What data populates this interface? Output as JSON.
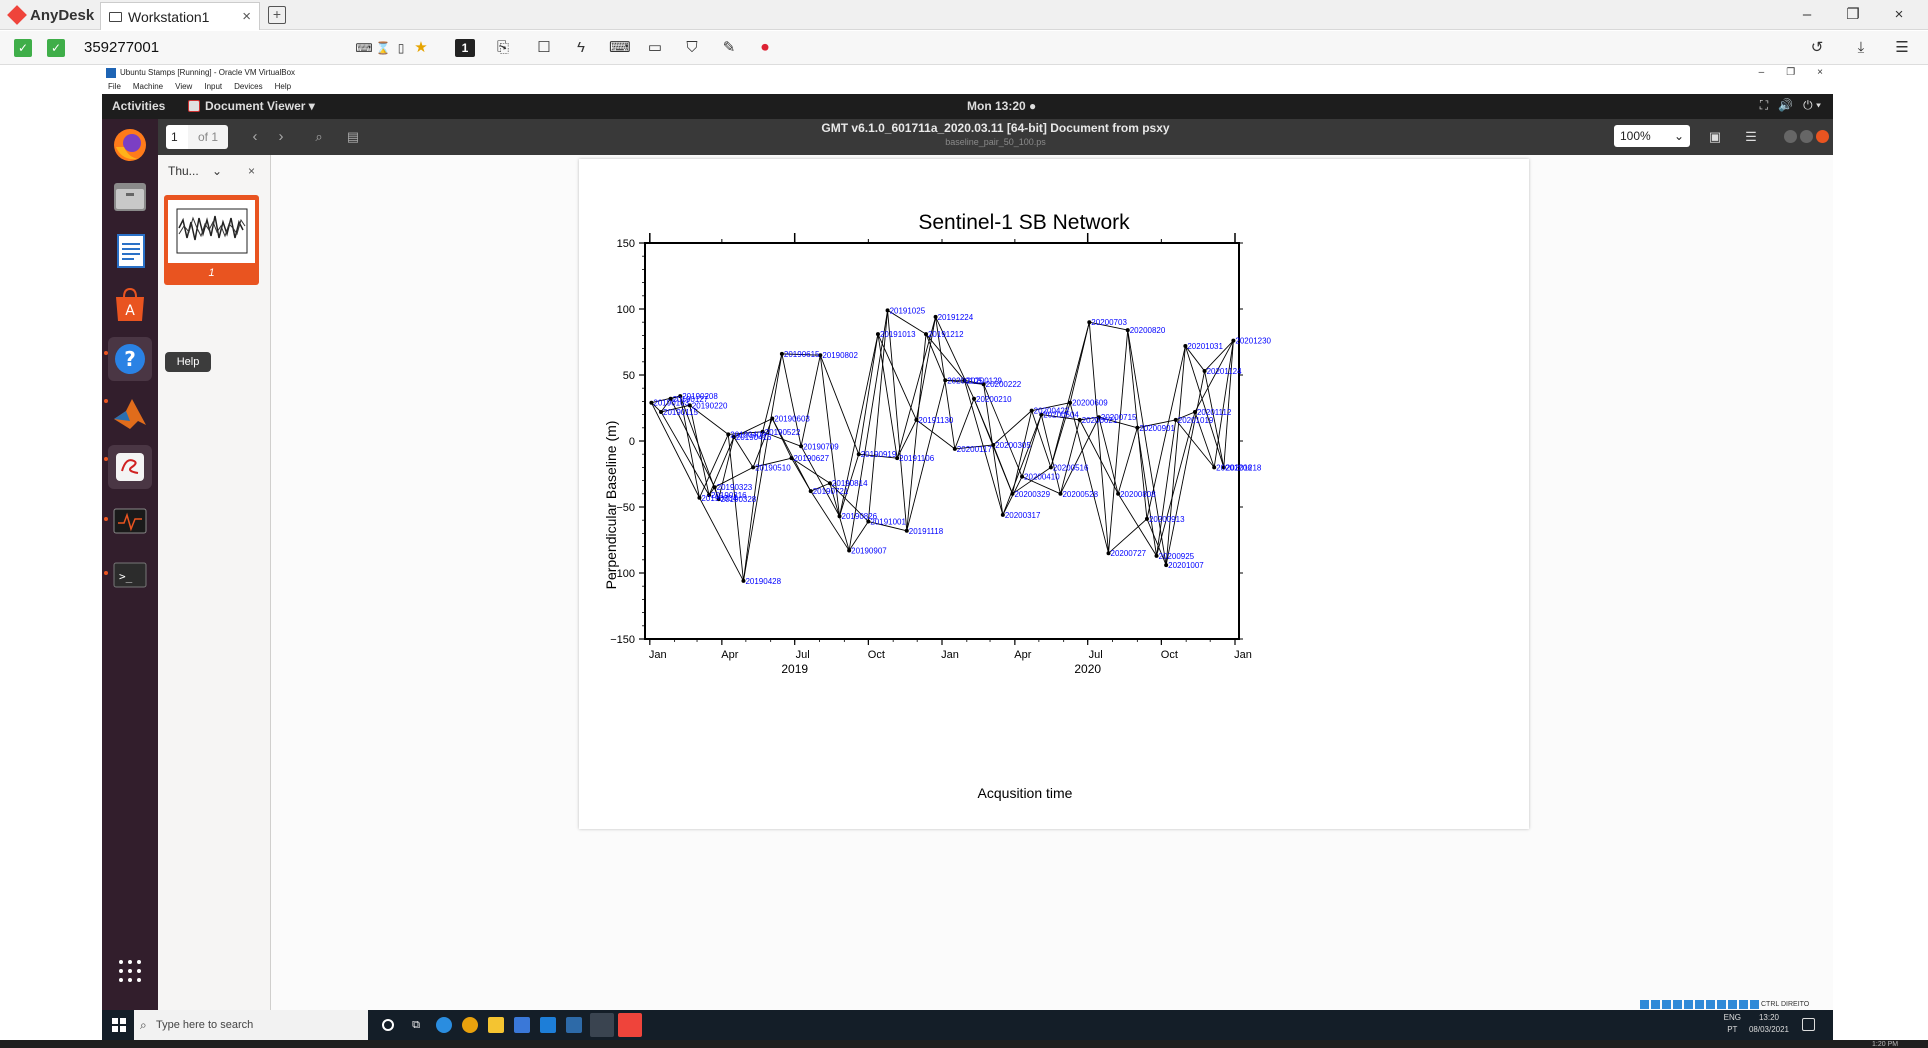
{
  "anydesk": {
    "brand": "AnyDesk",
    "tab_label": "Workstation1",
    "tab_close": "×",
    "new_tab": "+",
    "address": "359277001",
    "display_number": "1",
    "window_controls": [
      "–",
      "❐",
      "×"
    ]
  },
  "vbox": {
    "title": "Ubuntu Stamps [Running] - Oracle VM VirtualBox",
    "menu": [
      "File",
      "Machine",
      "View",
      "Input",
      "Devices",
      "Help"
    ],
    "window_controls": [
      "–",
      "❐",
      "×"
    ],
    "status_host_key": "CTRL DIREITO"
  },
  "ubuntu": {
    "activities": "Activities",
    "app_name": "Document Viewer ▾",
    "clock": "Mon 13:20 ●",
    "status_icons": [
      "⛶",
      "🔊",
      "⏻ ▾"
    ],
    "help_tooltip": "Help",
    "dock_items": [
      "firefox-icon",
      "files-icon",
      "writer-icon",
      "software-icon",
      "help-icon",
      "matlab-icon",
      "document-viewer-icon",
      "system-monitor-icon",
      "terminal-icon",
      "show-apps-icon"
    ]
  },
  "evince": {
    "page_number": "1",
    "page_of": "of 1",
    "title": "GMT v6.1.0_601711a_2020.03.11 [64-bit] Document from psxy",
    "subtitle": "baseline_pair_50_100.ps",
    "zoom": "100%",
    "sidebar_mode": "Thu...",
    "sidebar_mode_chevron": "⌄",
    "sidebar_close": "×",
    "thumbnail_page": "1"
  },
  "chart_data": {
    "type": "scatter",
    "title": "Sentinel-1 SB Network",
    "xlabel": "Acqusition time",
    "ylabel": "Perpendicular Baseline (m)",
    "ylim": [
      -150,
      150
    ],
    "yticks": [
      -150,
      -100,
      -50,
      0,
      50,
      100,
      150
    ],
    "ytick_labels": [
      "−150",
      "−100",
      "−50",
      "0",
      "50",
      "100",
      "150"
    ],
    "xlim": [
      "2018-12-26",
      "2021-01-06"
    ],
    "xtick_dates": [
      "2019-01-01",
      "2019-04-01",
      "2019-07-01",
      "2019-10-01",
      "2020-01-01",
      "2020-04-01",
      "2020-07-01",
      "2020-10-01",
      "2021-01-01"
    ],
    "xtick_labels": [
      "Jan",
      "Apr",
      "Jul",
      "Oct",
      "Jan",
      "Apr",
      "Jul",
      "Oct",
      "Jan"
    ],
    "year_ticks": [
      "2019-07-01",
      "2020-07-01"
    ],
    "year_labels": [
      "2019",
      "2020"
    ],
    "point_color": "#0000ff",
    "line_color": "#000000",
    "points": [
      {
        "date": "2019-01-03",
        "y": 29,
        "label": "20190103"
      },
      {
        "date": "2019-01-15",
        "y": 22,
        "label": "20190115"
      },
      {
        "date": "2019-01-27",
        "y": 32,
        "label": "20190127"
      },
      {
        "date": "2019-02-08",
        "y": 34,
        "label": "20190208"
      },
      {
        "date": "2019-02-20",
        "y": 27,
        "label": "20190220"
      },
      {
        "date": "2019-03-04",
        "y": -43,
        "label": "20190304"
      },
      {
        "date": "2019-03-16",
        "y": -41,
        "label": "20190316"
      },
      {
        "date": "2019-03-23",
        "y": -35,
        "label": "20190323"
      },
      {
        "date": "2019-03-28",
        "y": -44,
        "label": "20190328"
      },
      {
        "date": "2019-04-09",
        "y": 5,
        "label": "20190409"
      },
      {
        "date": "2019-04-16",
        "y": 3,
        "label": "20190416"
      },
      {
        "date": "2019-04-28",
        "y": -106,
        "label": "20190428"
      },
      {
        "date": "2019-05-10",
        "y": -20,
        "label": "20190510"
      },
      {
        "date": "2019-05-22",
        "y": 7,
        "label": "20190522"
      },
      {
        "date": "2019-06-03",
        "y": 17,
        "label": "20190603"
      },
      {
        "date": "2019-06-15",
        "y": 66,
        "label": "20190615"
      },
      {
        "date": "2019-06-27",
        "y": -13,
        "label": "20190627"
      },
      {
        "date": "2019-07-09",
        "y": -4,
        "label": "20190709"
      },
      {
        "date": "2019-07-21",
        "y": -38,
        "label": "20190721"
      },
      {
        "date": "2019-08-02",
        "y": 65,
        "label": "20190802"
      },
      {
        "date": "2019-08-14",
        "y": -32,
        "label": "20190814"
      },
      {
        "date": "2019-08-26",
        "y": -57,
        "label": "20190826"
      },
      {
        "date": "2019-09-07",
        "y": -83,
        "label": "20190907"
      },
      {
        "date": "2019-09-19",
        "y": -10,
        "label": "20190919"
      },
      {
        "date": "2019-10-01",
        "y": -61,
        "label": "20191001"
      },
      {
        "date": "2019-10-13",
        "y": 81,
        "label": "20191013"
      },
      {
        "date": "2019-10-25",
        "y": 99,
        "label": "20191025"
      },
      {
        "date": "2019-11-06",
        "y": -13,
        "label": "20191106"
      },
      {
        "date": "2019-11-18",
        "y": -68,
        "label": "20191118"
      },
      {
        "date": "2019-11-30",
        "y": 16,
        "label": "20191130"
      },
      {
        "date": "2019-12-12",
        "y": 81,
        "label": "20191212"
      },
      {
        "date": "2019-12-24",
        "y": 94,
        "label": "20191224"
      },
      {
        "date": "2020-01-05",
        "y": 46,
        "label": "20200105"
      },
      {
        "date": "2020-01-17",
        "y": -6,
        "label": "20200117"
      },
      {
        "date": "2020-01-29",
        "y": 46,
        "label": "20200129"
      },
      {
        "date": "2020-02-10",
        "y": 32,
        "label": "20200210"
      },
      {
        "date": "2020-02-22",
        "y": 43,
        "label": "20200222"
      },
      {
        "date": "2020-03-05",
        "y": -3,
        "label": "20200305"
      },
      {
        "date": "2020-03-17",
        "y": -56,
        "label": "20200317"
      },
      {
        "date": "2020-03-29",
        "y": -40,
        "label": "20200329"
      },
      {
        "date": "2020-04-10",
        "y": -27,
        "label": "20200410"
      },
      {
        "date": "2020-04-22",
        "y": 23,
        "label": "20200422"
      },
      {
        "date": "2020-05-04",
        "y": 20,
        "label": "20200504"
      },
      {
        "date": "2020-05-16",
        "y": -20,
        "label": "20200516"
      },
      {
        "date": "2020-05-28",
        "y": -40,
        "label": "20200528"
      },
      {
        "date": "2020-06-09",
        "y": 29,
        "label": "20200609"
      },
      {
        "date": "2020-06-21",
        "y": 16,
        "label": "20200621"
      },
      {
        "date": "2020-07-03",
        "y": 90,
        "label": "20200703"
      },
      {
        "date": "2020-07-15",
        "y": 18,
        "label": "20200715"
      },
      {
        "date": "2020-07-27",
        "y": -85,
        "label": "20200727"
      },
      {
        "date": "2020-08-08",
        "y": -40,
        "label": "20200808"
      },
      {
        "date": "2020-08-20",
        "y": 84,
        "label": "20200820"
      },
      {
        "date": "2020-09-01",
        "y": 10,
        "label": "20200901"
      },
      {
        "date": "2020-09-13",
        "y": -59,
        "label": "20200913"
      },
      {
        "date": "2020-09-25",
        "y": -87,
        "label": "20200925"
      },
      {
        "date": "2020-10-07",
        "y": -94,
        "label": "20201007"
      },
      {
        "date": "2020-10-19",
        "y": 16,
        "label": "20201019"
      },
      {
        "date": "2020-10-31",
        "y": 72,
        "label": "20201031"
      },
      {
        "date": "2020-11-12",
        "y": 22,
        "label": "20201112"
      },
      {
        "date": "2020-11-24",
        "y": 53,
        "label": "20201124"
      },
      {
        "date": "2020-12-06",
        "y": -20,
        "label": "20201206"
      },
      {
        "date": "2020-12-18",
        "y": -20,
        "label": "20201218"
      },
      {
        "date": "2020-12-30",
        "y": 76,
        "label": "20201230"
      }
    ],
    "pairs": [
      [
        0,
        1
      ],
      [
        0,
        3
      ],
      [
        0,
        5
      ],
      [
        1,
        2
      ],
      [
        1,
        4
      ],
      [
        1,
        6
      ],
      [
        2,
        3
      ],
      [
        2,
        7
      ],
      [
        3,
        5
      ],
      [
        3,
        8
      ],
      [
        4,
        6
      ],
      [
        4,
        9
      ],
      [
        5,
        9
      ],
      [
        5,
        11
      ],
      [
        6,
        10
      ],
      [
        6,
        7
      ],
      [
        7,
        8
      ],
      [
        7,
        12
      ],
      [
        8,
        10
      ],
      [
        9,
        11
      ],
      [
        9,
        13
      ],
      [
        10,
        12
      ],
      [
        10,
        14
      ],
      [
        11,
        13
      ],
      [
        11,
        15
      ],
      [
        12,
        14
      ],
      [
        12,
        16
      ],
      [
        13,
        15
      ],
      [
        13,
        17
      ],
      [
        14,
        16
      ],
      [
        14,
        18
      ],
      [
        15,
        17
      ],
      [
        15,
        19
      ],
      [
        16,
        18
      ],
      [
        16,
        20
      ],
      [
        17,
        19
      ],
      [
        17,
        21
      ],
      [
        18,
        20
      ],
      [
        18,
        22
      ],
      [
        19,
        21
      ],
      [
        19,
        23
      ],
      [
        20,
        22
      ],
      [
        20,
        24
      ],
      [
        21,
        23
      ],
      [
        21,
        25
      ],
      [
        22,
        24
      ],
      [
        22,
        26
      ],
      [
        23,
        25
      ],
      [
        23,
        27
      ],
      [
        24,
        26
      ],
      [
        24,
        28
      ],
      [
        25,
        27
      ],
      [
        25,
        29
      ],
      [
        26,
        28
      ],
      [
        26,
        30
      ],
      [
        27,
        29
      ],
      [
        27,
        31
      ],
      [
        28,
        30
      ],
      [
        28,
        32
      ],
      [
        29,
        31
      ],
      [
        29,
        33
      ],
      [
        30,
        32
      ],
      [
        30,
        34
      ],
      [
        31,
        33
      ],
      [
        31,
        35
      ],
      [
        32,
        34
      ],
      [
        32,
        36
      ],
      [
        33,
        35
      ],
      [
        33,
        37
      ],
      [
        34,
        36
      ],
      [
        34,
        38
      ],
      [
        35,
        37
      ],
      [
        35,
        39
      ],
      [
        36,
        38
      ],
      [
        36,
        40
      ],
      [
        37,
        39
      ],
      [
        37,
        41
      ],
      [
        38,
        40
      ],
      [
        38,
        42
      ],
      [
        39,
        41
      ],
      [
        39,
        43
      ],
      [
        40,
        42
      ],
      [
        40,
        44
      ],
      [
        41,
        43
      ],
      [
        41,
        45
      ],
      [
        42,
        44
      ],
      [
        42,
        46
      ],
      [
        43,
        45
      ],
      [
        43,
        47
      ],
      [
        44,
        46
      ],
      [
        44,
        48
      ],
      [
        45,
        47
      ],
      [
        45,
        49
      ],
      [
        46,
        48
      ],
      [
        46,
        50
      ],
      [
        47,
        49
      ],
      [
        47,
        51
      ],
      [
        48,
        50
      ],
      [
        48,
        52
      ],
      [
        49,
        51
      ],
      [
        49,
        53
      ],
      [
        50,
        52
      ],
      [
        50,
        54
      ],
      [
        51,
        53
      ],
      [
        51,
        55
      ],
      [
        52,
        54
      ],
      [
        52,
        56
      ],
      [
        53,
        55
      ],
      [
        53,
        57
      ],
      [
        54,
        56
      ],
      [
        54,
        58
      ],
      [
        55,
        57
      ],
      [
        55,
        59
      ],
      [
        56,
        58
      ],
      [
        56,
        60
      ],
      [
        57,
        59
      ],
      [
        57,
        61
      ],
      [
        58,
        60
      ],
      [
        58,
        62
      ],
      [
        59,
        61
      ],
      [
        59,
        62
      ],
      [
        60,
        62
      ],
      [
        61,
        62
      ]
    ]
  },
  "windows": {
    "search_placeholder": "Type here to search",
    "lang_top": "ENG",
    "lang_bottom": "PT",
    "time": "13:20",
    "date": "08/03/2021",
    "far_time": "1:20 PM"
  }
}
